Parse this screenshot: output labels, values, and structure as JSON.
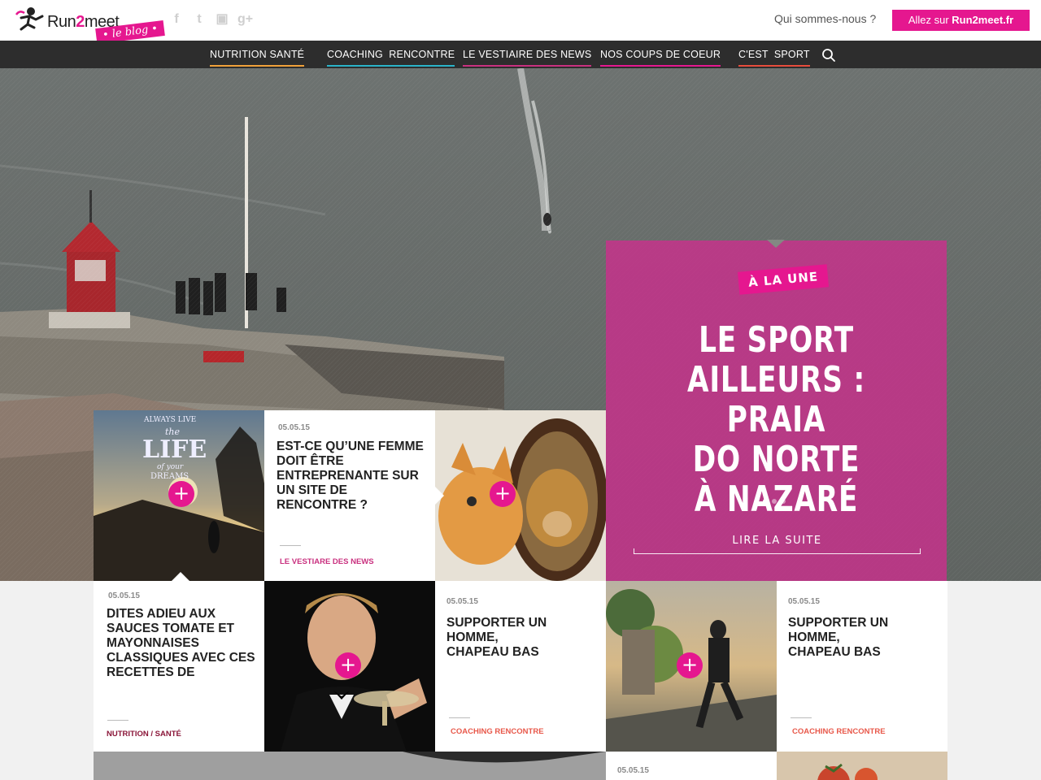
{
  "brand": {
    "name_part1": "Run",
    "name_part2": "2",
    "name_part3": "meet",
    "badge": "• le blog •"
  },
  "social": {
    "facebook": "f",
    "twitter": "t",
    "instagram": "▣",
    "googleplus": "g+"
  },
  "header": {
    "about_link": "Qui sommes-nous ?",
    "cta_prefix": "Allez sur ",
    "cta_site": "Run2meet.fr"
  },
  "nav": {
    "items": [
      {
        "label": "Nutrition Santé",
        "color": "#f0a13a"
      },
      {
        "label": "Coaching  Rencontre",
        "color": "#2ab3c9"
      },
      {
        "label": "Le vestiaire des news",
        "color": "#c9307f"
      },
      {
        "label": "Nos coups de coeur",
        "color": "#e5178f"
      },
      {
        "label": "C'est  sport",
        "color": "#e74c3c"
      }
    ],
    "search_icon": "magnifier-icon"
  },
  "featured": {
    "tag": "À LA UNE",
    "title": "Le sport ailleurs : Praia do Norte à Nazaré",
    "title_lines": [
      "LE SPORT",
      "AILLEURS : PRAIA",
      "DO NORTE",
      "À NAZARÉ"
    ],
    "dots": 3,
    "active_dot": 0,
    "read_more": "LIRE LA SUITE"
  },
  "cards": {
    "c1": {
      "date": "05.05.15",
      "title": "EST-CE QU’UNE FEMME DOIT ÊTRE ENTREPRENANTE SUR UN SITE DE RENCONTRE ?",
      "category": "LE VESTIARE DES NEWS",
      "category_color": "#c9307f"
    },
    "c2": {
      "date": "05.05.15",
      "title": "DITES ADIEU AUX SAUCES TOMATE ET MAYONNAISES CLASSIQUES AVEC CES RECETTES DE",
      "category": "NUTRITION / SANTÉ",
      "category_color": "#8a1538"
    },
    "c3": {
      "date": "05.05.15",
      "title": "SUPPORTER UN HOMME, CHAPEAU BAS",
      "category": "COACHING RENCONTRE",
      "category_color": "#e8584a"
    },
    "c4": {
      "date": "05.05.15",
      "title": "SUPPORTER UN HOMME, CHAPEAU BAS",
      "category": "COACHING RENCONTRE",
      "category_color": "#e8584a"
    },
    "c5": {
      "date": "05.05.15"
    }
  },
  "image_text": {
    "quote_line1": "ALWAYS LIVE",
    "quote_line2": "the",
    "quote_line3": "LIFE",
    "quote_line4": "of your",
    "quote_line5": "DREAMS"
  },
  "plus_symbol": "+"
}
